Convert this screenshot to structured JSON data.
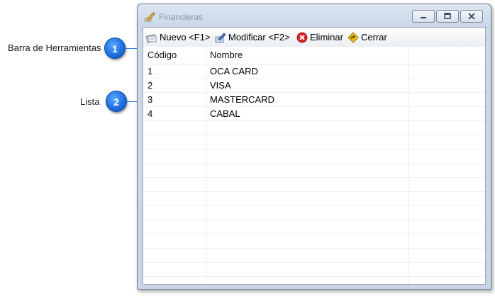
{
  "callouts": [
    {
      "number": "1",
      "label": "Barra de Herramientas"
    },
    {
      "number": "2",
      "label": "Lista"
    }
  ],
  "window": {
    "title": "Financieras",
    "icon": "edit-pencil-icon",
    "controls": [
      "minimize",
      "maximize",
      "close"
    ]
  },
  "toolbar": {
    "nuevo_label": "Nuevo <F1>",
    "modificar_label": "Modificar <F2>",
    "eliminar_label": "Eliminar",
    "cerrar_label": "Cerrar"
  },
  "list": {
    "columns": [
      "Código",
      "Nombre"
    ],
    "rows": [
      {
        "codigo": "1",
        "nombre": "OCA CARD"
      },
      {
        "codigo": "2",
        "nombre": "VISA"
      },
      {
        "codigo": "3",
        "nombre": "MASTERCARD"
      },
      {
        "codigo": "4",
        "nombre": "CABAL"
      }
    ]
  },
  "colors": {
    "callout_badge": "#1f6fe0",
    "eliminar_icon": "#d62020",
    "cerrar_icon": "#e8b400"
  }
}
